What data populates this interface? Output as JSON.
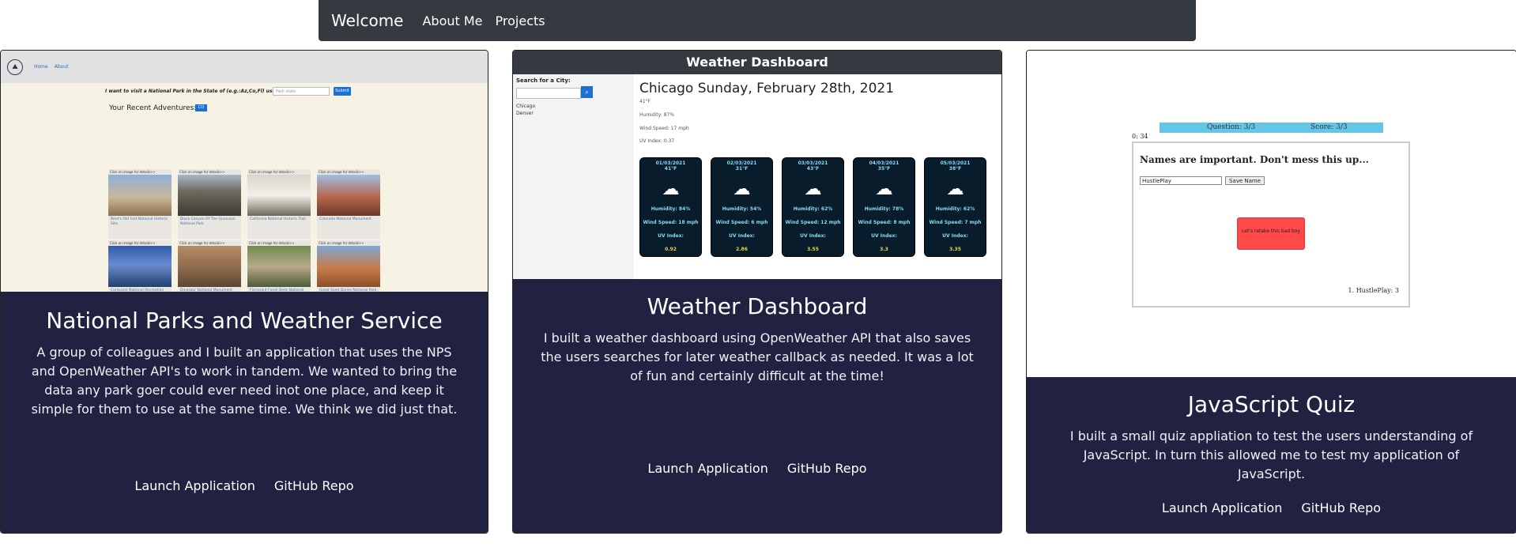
{
  "navbar": {
    "brand": "Welcome",
    "links": [
      "About Me",
      "Projects"
    ]
  },
  "colors": {
    "navbar_bg": "#343a40",
    "card_body_bg": "#212142",
    "text_light": "#ffffff"
  },
  "cards": [
    {
      "title": "National Parks and Weather Service",
      "description": "A group of colleagues and I built an application that uses the NPS and OpenWeather API's to work in tandem. We wanted to bring the data any park goer could ever need inot one place, and keep it simple for them to use at the same time. We think we did just that.",
      "launch_label": "Launch Application",
      "repo_label": "GitHub Repo",
      "preview": {
        "nav_links": [
          "Home",
          "About"
        ],
        "question": "I want to visit a National Park in the State of (e.g.:Az,Co,Fl) use state code:",
        "input_placeholder": "Park state",
        "submit_label": "Submit",
        "recent_label": "Your Recent Adventures:",
        "badge": "CO",
        "thumb_caption": "Click on image for details>>",
        "thumbs": [
          "Bent's Old Fort National Historic Site",
          "Black Canyon Of The Gunnison National Park",
          "California National Historic Trail",
          "Colorado National Monument",
          "Curecanti National Recreation Area",
          "Dinosaur National Monument",
          "Florissant Fossil Beds National Monument",
          "Great Sand Dunes National Park & Preserve",
          "",
          "",
          "",
          ""
        ]
      }
    },
    {
      "title": "Weather Dashboard",
      "description": "I built a weather dashboard using OpenWeather API that also saves the users searches for later weather callback as needed. It was a lot of fun and certainly difficult at the time!",
      "launch_label": "Launch Application",
      "repo_label": "GitHub Repo",
      "preview": {
        "bar_title": "Weather Dashboard",
        "search_label": "Search for a City:",
        "cities": [
          "Chicago",
          "Denver"
        ],
        "heading": "Chicago Sunday, February 28th, 2021",
        "temp": "41°F",
        "humidity": "Humidity: 87%",
        "wind": "Wind Speed: 17 mph",
        "uv": "UV Index: 0.37",
        "forecast": [
          {
            "date": "01/03/2021",
            "temp": "41°F",
            "humidity": "Humidity: 84%",
            "wind": "Wind Speed: 18 mph",
            "uv_label": "UV Index:",
            "uv": "0.92"
          },
          {
            "date": "02/03/2021",
            "temp": "31°F",
            "humidity": "Humidity: 54%",
            "wind": "Wind Speed: 6 mph",
            "uv_label": "UV Index:",
            "uv": "2.86"
          },
          {
            "date": "03/03/2021",
            "temp": "43°F",
            "humidity": "Humidity: 62%",
            "wind": "Wind Speed: 12 mph",
            "uv_label": "UV Index:",
            "uv": "3.55"
          },
          {
            "date": "04/03/2021",
            "temp": "35°F",
            "humidity": "Humidity: 78%",
            "wind": "Wind Speed: 8 mph",
            "uv_label": "UV Index:",
            "uv": "3.3"
          },
          {
            "date": "05/03/2021",
            "temp": "38°F",
            "humidity": "Humidity: 62%",
            "wind": "Wind Speed: 7 mph",
            "uv_label": "UV Index:",
            "uv": "3.35"
          }
        ]
      }
    },
    {
      "title": "JavaScript Quiz",
      "description": "I built a small quiz appliation to test the users understanding of JavaScript. In turn this allowed me to test my application of JavaScript.",
      "launch_label": "Launch Application",
      "repo_label": "GitHub Repo",
      "preview": {
        "question_status": "Question: 3/3",
        "score_status": "Score: 3/3",
        "timer": "0: 34",
        "heading": "Names are important. Don't mess this up...",
        "name_value": "HustlePlay",
        "save_label": "Save Name",
        "retake_label": "Let's retake this bad boy",
        "score_line": "1. HustlePlay: 3"
      }
    }
  ]
}
